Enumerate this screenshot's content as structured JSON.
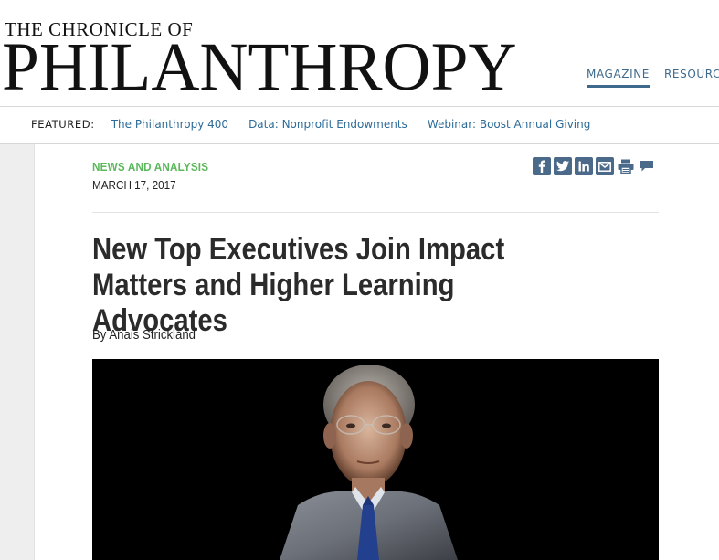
{
  "masthead": {
    "line1": "THE CHRONICLE OF",
    "line2": "PHILANTHROPY"
  },
  "topnav": {
    "items": [
      {
        "label": "MAGAZINE"
      },
      {
        "label": "RESOURCES"
      }
    ]
  },
  "featured": {
    "label": "FEATURED:",
    "links": [
      {
        "label": "The Philanthropy 400"
      },
      {
        "label": "Data: Nonprofit Endowments"
      },
      {
        "label": "Webinar: Boost Annual Giving"
      }
    ]
  },
  "article": {
    "section": "NEWS AND ANALYSIS",
    "date": "MARCH 17, 2017",
    "headline": "New Top Executives Join Impact Matters and Higher Learning Advocates",
    "byline_prefix": "By",
    "author": "Anais Strickland"
  },
  "share": {
    "icons": [
      "facebook-icon",
      "twitter-icon",
      "linkedin-icon",
      "email-icon",
      "print-icon",
      "comment-icon"
    ]
  },
  "colors": {
    "accent_green": "#5cb85c",
    "link_blue": "#2d6b98",
    "nav_blue": "#3d6a8c",
    "share_icon_bg": "#4b6a8a"
  }
}
